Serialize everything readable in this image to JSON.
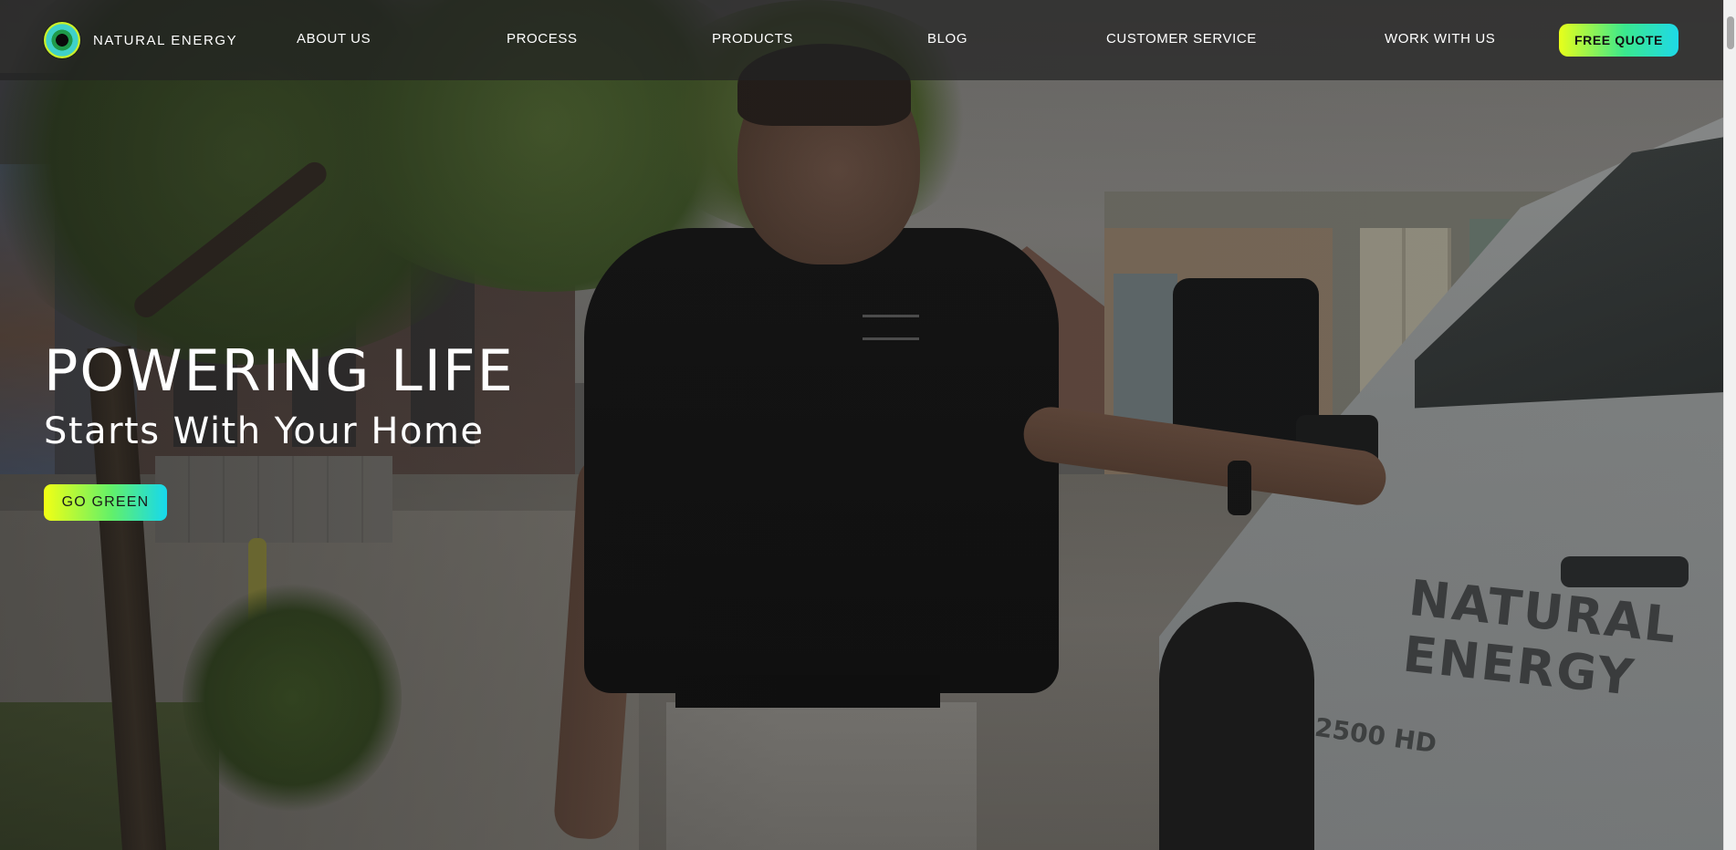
{
  "brand": {
    "name": "NATURAL ENERGY",
    "logo_icon": "natural-energy-logo-icon",
    "gradient_colors": [
      "#e8ff1a",
      "#3ae88e",
      "#1ed9e8"
    ]
  },
  "nav": {
    "items": [
      {
        "label": "ABOUT US"
      },
      {
        "label": "PROCESS"
      },
      {
        "label": "PRODUCTS"
      },
      {
        "label": "BLOG"
      },
      {
        "label": "CUSTOMER SERVICE"
      },
      {
        "label": "WORK WITH US"
      }
    ],
    "cta_label": "FREE QUOTE"
  },
  "hero": {
    "title": "POWERING LIFE",
    "subtitle": "Starts With Your Home",
    "cta_label": "GO GREEN"
  }
}
